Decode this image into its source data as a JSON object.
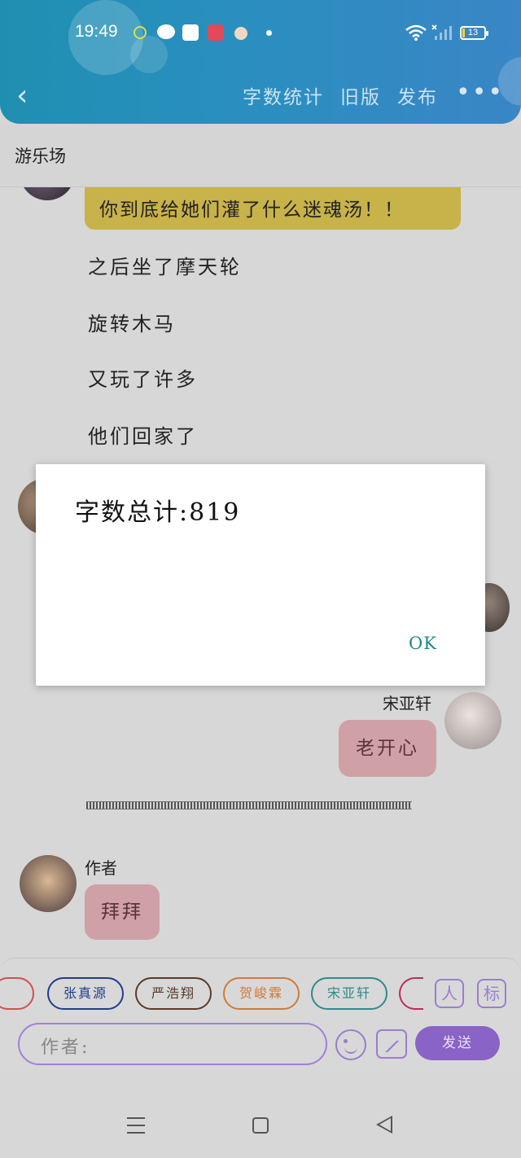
{
  "status_bar": {
    "time": "19:49",
    "battery": "13"
  },
  "header": {
    "word_count_label": "字数统计",
    "old_version_label": "旧版",
    "publish_label": "发布",
    "more_label": "•••"
  },
  "chapter": {
    "title": "游乐场"
  },
  "chat": {
    "highlight_message": "你到底给她们灌了什么迷魂汤！！",
    "lines": [
      "之后坐了摩天轮",
      "旋转木马",
      "又玩了许多",
      "他们回家了"
    ],
    "message_song": {
      "sender": "宋亚轩",
      "text": "老开心"
    },
    "message_author": {
      "sender": "作者",
      "text": "拜拜"
    }
  },
  "dialog": {
    "message": "字数总计:819",
    "ok_label": "OK"
  },
  "character_buttons": [
    {
      "label": "张真源",
      "color": "#1f3d8a"
    },
    {
      "label": "严浩翔",
      "color": "#5a3a2a"
    },
    {
      "label": "贺峻霖",
      "color": "#d07a3a"
    },
    {
      "label": "宋亚轩",
      "color": "#2f8a8a"
    }
  ],
  "icons": {
    "profile": "人",
    "tag": "标"
  },
  "input": {
    "placeholder": "作者:"
  },
  "send_label": "发送"
}
